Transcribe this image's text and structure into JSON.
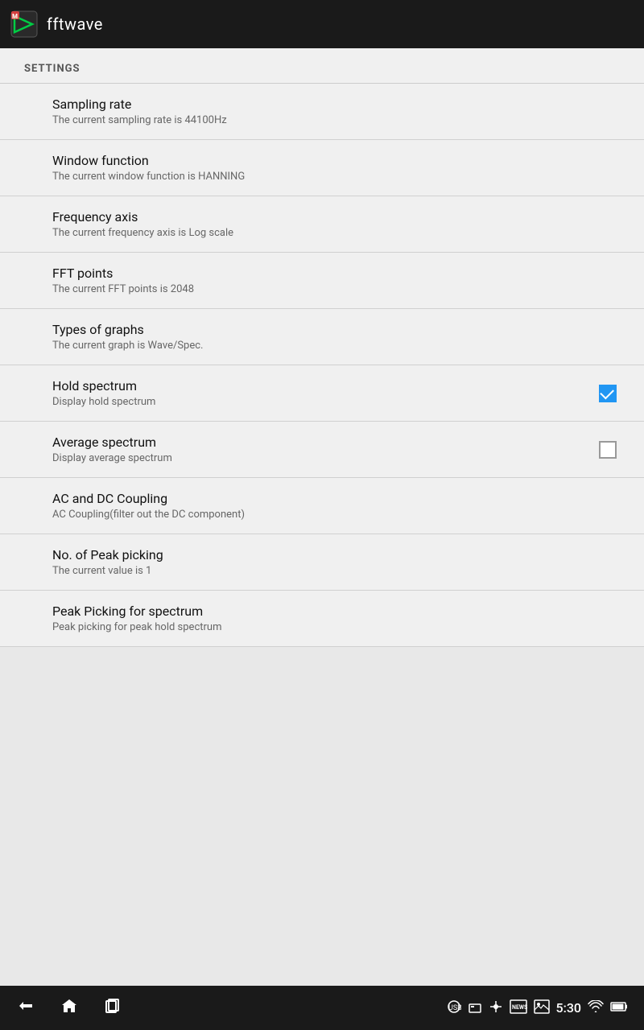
{
  "appBar": {
    "title": "fftwave"
  },
  "settings": {
    "sectionLabel": "SETTINGS",
    "items": [
      {
        "id": "sampling-rate",
        "title": "Sampling rate",
        "subtitle": "The current sampling rate is 44100Hz",
        "hasCheckbox": false,
        "checked": false
      },
      {
        "id": "window-function",
        "title": "Window function",
        "subtitle": "The current window function is HANNING",
        "hasCheckbox": false,
        "checked": false
      },
      {
        "id": "frequency-axis",
        "title": "Frequency axis",
        "subtitle": "The current frequency axis is Log scale",
        "hasCheckbox": false,
        "checked": false
      },
      {
        "id": "fft-points",
        "title": "FFT points",
        "subtitle": "The current FFT points is 2048",
        "hasCheckbox": false,
        "checked": false
      },
      {
        "id": "types-of-graphs",
        "title": "Types of graphs",
        "subtitle": "The current graph is Wave/Spec.",
        "hasCheckbox": false,
        "checked": false
      },
      {
        "id": "hold-spectrum",
        "title": "Hold spectrum",
        "subtitle": "Display hold spectrum",
        "hasCheckbox": true,
        "checked": true
      },
      {
        "id": "average-spectrum",
        "title": "Average spectrum",
        "subtitle": "Display average spectrum",
        "hasCheckbox": true,
        "checked": false
      },
      {
        "id": "ac-dc-coupling",
        "title": "AC and DC Coupling",
        "subtitle": "AC Coupling(filter out the DC component)",
        "hasCheckbox": false,
        "checked": false
      },
      {
        "id": "peak-picking-no",
        "title": "No. of Peak picking",
        "subtitle": "The current value is 1",
        "hasCheckbox": false,
        "checked": false
      },
      {
        "id": "peak-picking-spectrum",
        "title": "Peak Picking for spectrum",
        "subtitle": "Peak picking for peak hold spectrum",
        "hasCheckbox": false,
        "checked": false
      }
    ]
  },
  "bottomBar": {
    "time": "5:30",
    "navIcons": [
      "back",
      "home",
      "recents"
    ],
    "statusIcons": [
      "usb",
      "storage",
      "usb2",
      "news",
      "image",
      "wifi",
      "battery"
    ]
  }
}
